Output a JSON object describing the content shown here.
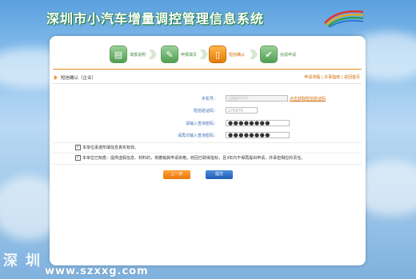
{
  "header": {
    "title": "深圳市小汽车增量调控管理信息系统"
  },
  "steps": [
    {
      "label": "填报说明",
      "icon": "document-icon",
      "active": false
    },
    {
      "label": "申报填写",
      "icon": "edit-form-icon",
      "active": false
    },
    {
      "label": "短信确认",
      "icon": "sms-phone-icon",
      "active": true
    },
    {
      "label": "完成申请",
      "icon": "checkmark-icon",
      "active": false
    }
  ],
  "section": {
    "title": "短信确认（企业）"
  },
  "top_links": {
    "flow": "申请流程",
    "guide": "办事指南",
    "home": "返回首页",
    "sep": "|"
  },
  "form": {
    "phone_label": "手机号：",
    "phone_value": "1350*****",
    "send_code_link": "点击获取短信验证码",
    "sms_code_label": "短信验证码：",
    "sms_code_value": "276876",
    "password_label": "请输入查询密码：",
    "password_value": "●●●●●●●●",
    "confirm_label": "请再次输入查询密码：",
    "confirm_value": "●●●●●●●●"
  },
  "declarations": {
    "d1": "本单位承诺所填信息真实有效。",
    "d2": "本单位已知悉：提供虚假信息、材料的，将撤销其申请资格，收回已取得指标，且3年内不得再提出申请，并承担相应的责任。"
  },
  "buttons": {
    "prev": "上一步",
    "submit": "提交"
  },
  "watermark": {
    "cn": "深圳",
    "url": "www.szxxg.com"
  },
  "colors": {
    "accent": "#f08d1d",
    "submit": "#1f5cb6",
    "step_done": "#4f9e4f"
  }
}
